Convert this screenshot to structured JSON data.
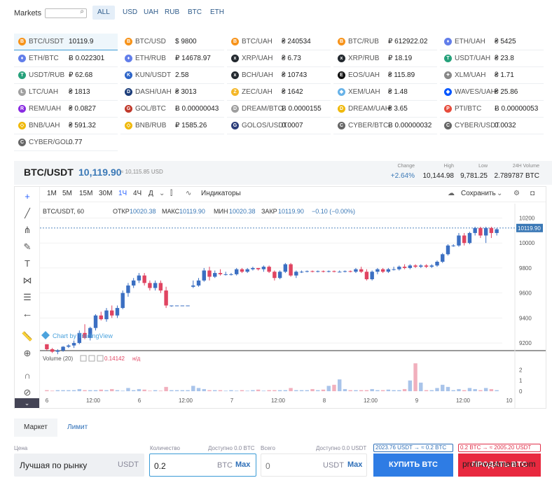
{
  "markets": {
    "title": "Markets",
    "search_icon": "search-icon",
    "currencies": [
      "ALL",
      "USD",
      "UAH",
      "RUB",
      "BTC",
      "ETH"
    ],
    "active_currency": "ALL",
    "pairs": [
      [
        {
          "name": "BTC/USDT",
          "price": "10119.9",
          "icon": "btc-icon",
          "color": "#f7931a",
          "sym": "B"
        },
        {
          "name": "BTC/USD",
          "price": "$ 9800",
          "icon": "btc-icon",
          "color": "#f7931a",
          "sym": "B"
        },
        {
          "name": "BTC/UAH",
          "price": "₴ 240534",
          "icon": "btc-icon",
          "color": "#f7931a",
          "sym": "B"
        },
        {
          "name": "BTC/RUB",
          "price": "₽ 612922.02",
          "icon": "btc-icon",
          "color": "#f7931a",
          "sym": "B"
        },
        {
          "name": "ETH/UAH",
          "price": "₴ 5425",
          "icon": "eth-icon",
          "color": "#627eea",
          "sym": "♦"
        }
      ],
      [
        {
          "name": "ETH/BTC",
          "price": "Ƀ 0.022301",
          "icon": "eth-icon",
          "color": "#627eea",
          "sym": "♦"
        },
        {
          "name": "ETH/RUB",
          "price": "₽ 14678.97",
          "icon": "eth-icon",
          "color": "#627eea",
          "sym": "♦"
        },
        {
          "name": "XRP/UAH",
          "price": "₴ 6.73",
          "icon": "xrp-icon",
          "color": "#23292f",
          "sym": "x"
        },
        {
          "name": "XRP/RUB",
          "price": "₽ 18.19",
          "icon": "xrp-icon",
          "color": "#23292f",
          "sym": "x"
        },
        {
          "name": "USDT/UAH",
          "price": "₴ 23.8",
          "icon": "usdt-icon",
          "color": "#26a17b",
          "sym": "T"
        }
      ],
      [
        {
          "name": "USDT/RUB",
          "price": "₽ 62.68",
          "icon": "usdt-icon",
          "color": "#26a17b",
          "sym": "T"
        },
        {
          "name": "KUN/USDT",
          "price": "2.58",
          "icon": "kun-icon",
          "color": "#2c64c8",
          "sym": "K"
        },
        {
          "name": "BCH/UAH",
          "price": "₴ 10743",
          "icon": "bch-icon",
          "color": "#23292f",
          "sym": "x"
        },
        {
          "name": "EOS/UAH",
          "price": "₴ 115.89",
          "icon": "eos-icon",
          "color": "#111111",
          "sym": "E"
        },
        {
          "name": "XLM/UAH",
          "price": "₴ 1.71",
          "icon": "xlm-icon",
          "color": "#888888",
          "sym": "✦"
        }
      ],
      [
        {
          "name": "LTC/UAH",
          "price": "₴ 1813",
          "icon": "ltc-icon",
          "color": "#a0a0a0",
          "sym": "Ł"
        },
        {
          "name": "DASH/UAH",
          "price": "₴ 3013",
          "icon": "dash-icon",
          "color": "#1c3d7a",
          "sym": "D"
        },
        {
          "name": "ZEC/UAH",
          "price": "₴ 1642",
          "icon": "zec-icon",
          "color": "#f4b728",
          "sym": "Z"
        },
        {
          "name": "XEM/UAH",
          "price": "₴ 1.48",
          "icon": "xem-icon",
          "color": "#67b2e8",
          "sym": "◆"
        },
        {
          "name": "WAVES/UAH",
          "price": "₴ 25.86",
          "icon": "waves-icon",
          "color": "#0055ff",
          "sym": "◆"
        }
      ],
      [
        {
          "name": "REM/UAH",
          "price": "₴ 0.0827",
          "icon": "rem-icon",
          "color": "#8a2be2",
          "sym": "R"
        },
        {
          "name": "GOL/BTC",
          "price": "Ƀ 0.00000043",
          "icon": "gol-icon",
          "color": "#c0392b",
          "sym": "G"
        },
        {
          "name": "DREAM/BTC",
          "price": "Ƀ 0.0000155",
          "icon": "dream-icon",
          "color": "#9e9e9e",
          "sym": "D"
        },
        {
          "name": "DREAM/UAH",
          "price": "₴ 3.65",
          "icon": "dream-icon",
          "color": "#f0b90b",
          "sym": "D"
        },
        {
          "name": "PTI/BTC",
          "price": "Ƀ 0.00000053",
          "icon": "pti-icon",
          "color": "#e74c3c",
          "sym": "P"
        }
      ],
      [
        {
          "name": "BNB/UAH",
          "price": "₴ 591.32",
          "icon": "bnb-icon",
          "color": "#f0b90b",
          "sym": "◇"
        },
        {
          "name": "BNB/RUB",
          "price": "₽ 1585.26",
          "icon": "bnb-icon",
          "color": "#f0b90b",
          "sym": "◇"
        },
        {
          "name": "GOLOS/USDT",
          "price": "0.0007",
          "icon": "golos-icon",
          "color": "#2c3e7a",
          "sym": "G"
        },
        {
          "name": "CYBER/BTC",
          "price": "Ƀ 0.00000032",
          "icon": "cyber-icon",
          "color": "#666666",
          "sym": "C"
        },
        {
          "name": "CYBER/USDT",
          "price": "0.0032",
          "icon": "cyber-icon",
          "color": "#666666",
          "sym": "C"
        }
      ],
      [
        {
          "name": "CYBER/GOL",
          "price": "0.77",
          "icon": "cyber-icon",
          "color": "#666666",
          "sym": "C"
        }
      ]
    ]
  },
  "header": {
    "pair": "BTC/USDT",
    "price": "10,119.90",
    "sub_price": "≈ 10,115.85 USD",
    "stats": [
      {
        "label": "Change",
        "value": "+2.64%",
        "color": "#3a78b6"
      },
      {
        "label": "High",
        "value": "10,144.98",
        "color": "#222"
      },
      {
        "label": "Low",
        "value": "9,781.25",
        "color": "#222"
      },
      {
        "label": "24H Volume",
        "value": "2.789787 BTC",
        "color": "#222"
      }
    ]
  },
  "toolbar": {
    "timeframes": [
      "1M",
      "5M",
      "15M",
      "30M",
      "1Ч",
      "4Ч",
      "Д"
    ],
    "active_timeframe": "1Ч",
    "indicators_label": "Индикаторы",
    "save_label": "Сохранить"
  },
  "legend": {
    "symbol": "BTC/USDT, 60",
    "o_label": "ОТКР",
    "o_val": "10020.38",
    "h_label": "МАКС",
    "h_val": "10119.90",
    "l_label": "МИН",
    "l_val": "10020.38",
    "c_label": "ЗАКР",
    "c_val": "10119.90",
    "change": "−0.10 (−0.00%)",
    "volume_label": "Volume (20)",
    "volume_val": "0.14142",
    "volume_na": "н/д",
    "watermark": "Chart by TradingView"
  },
  "chart_data": {
    "type": "candlestick",
    "price_axis": [
      10200,
      10000,
      9800,
      9600,
      9400,
      9200
    ],
    "price_range": [
      9150,
      10270
    ],
    "current_price_label": "10119.90",
    "volume_axis": [
      2,
      1,
      0
    ],
    "volume_range": [
      0,
      3
    ],
    "time_axis": [
      "6",
      "12:00",
      "6",
      "12:00",
      "7",
      "12:00",
      "8",
      "12:00",
      "9",
      "12:00",
      "10"
    ],
    "candles": [
      [
        9190,
        9190,
        9140,
        9150
      ],
      [
        9150,
        9160,
        9120,
        9130
      ],
      [
        9130,
        9150,
        9110,
        9140
      ],
      [
        9140,
        9175,
        9130,
        9170
      ],
      [
        9170,
        9190,
        9160,
        9180
      ],
      [
        9180,
        9220,
        9160,
        9200
      ],
      [
        9200,
        9300,
        9190,
        9280
      ],
      [
        9280,
        9350,
        9230,
        9240
      ],
      [
        9240,
        9330,
        9220,
        9320
      ],
      [
        9320,
        9430,
        9300,
        9420
      ],
      [
        9420,
        9450,
        9380,
        9390
      ],
      [
        9390,
        9480,
        9370,
        9460
      ],
      [
        9460,
        9500,
        9400,
        9420
      ],
      [
        9420,
        9500,
        9400,
        9480
      ],
      [
        9480,
        9620,
        9470,
        9600
      ],
      [
        9600,
        9680,
        9570,
        9660
      ],
      [
        9660,
        9720,
        9640,
        9700
      ],
      [
        9700,
        9760,
        9680,
        9740
      ],
      [
        9740,
        9760,
        9660,
        9680
      ],
      [
        9680,
        9700,
        9620,
        9640
      ],
      [
        9640,
        9700,
        9620,
        9680
      ],
      [
        9680,
        9700,
        9600,
        9620
      ],
      [
        9620,
        9650,
        9480,
        9500
      ],
      [
        9500,
        9500,
        9490,
        9500
      ],
      [
        9500,
        9500,
        9495,
        9500
      ],
      [
        9500,
        9500,
        9495,
        9500
      ],
      [
        9500,
        9500,
        9495,
        9500
      ],
      [
        9650,
        9700,
        9640,
        9660
      ],
      [
        9660,
        9720,
        9650,
        9700
      ],
      [
        9700,
        9800,
        9690,
        9780
      ],
      [
        9780,
        9810,
        9700,
        9730
      ],
      [
        9730,
        9780,
        9720,
        9760
      ],
      [
        9760,
        9790,
        9740,
        9750
      ],
      [
        9750,
        9770,
        9740,
        9750
      ],
      [
        9750,
        9760,
        9740,
        9750
      ],
      [
        9750,
        9800,
        9740,
        9790
      ],
      [
        9790,
        9800,
        9760,
        9770
      ],
      [
        9770,
        9800,
        9760,
        9790
      ],
      [
        9790,
        9810,
        9780,
        9800
      ],
      [
        9800,
        9800,
        9780,
        9790
      ],
      [
        9790,
        9820,
        9770,
        9810
      ],
      [
        9810,
        9820,
        9760,
        9770
      ],
      [
        9770,
        9780,
        9700,
        9720
      ],
      [
        9720,
        9780,
        9710,
        9770
      ],
      [
        9770,
        9840,
        9760,
        9830
      ],
      [
        9830,
        9840,
        9730,
        9740
      ],
      [
        9740,
        9780,
        9720,
        9770
      ],
      [
        9770,
        9780,
        9760,
        9770
      ],
      [
        9770,
        9780,
        9765,
        9775
      ],
      [
        9775,
        9780,
        9765,
        9770
      ],
      [
        9770,
        9780,
        9765,
        9775
      ],
      [
        9775,
        9780,
        9765,
        9770
      ],
      [
        9770,
        9780,
        9765,
        9775
      ],
      [
        9775,
        9780,
        9765,
        9770
      ],
      [
        9770,
        9780,
        9765,
        9770
      ],
      [
        9770,
        9780,
        9765,
        9775
      ],
      [
        9775,
        9780,
        9765,
        9770
      ],
      [
        9770,
        9800,
        9760,
        9790
      ],
      [
        9790,
        9810,
        9760,
        9770
      ],
      [
        9770,
        9790,
        9700,
        9710
      ],
      [
        9710,
        9780,
        9700,
        9770
      ],
      [
        9770,
        9800,
        9750,
        9790
      ],
      [
        9790,
        9800,
        9760,
        9770
      ],
      [
        9770,
        9800,
        9760,
        9790
      ],
      [
        9790,
        9810,
        9780,
        9790
      ],
      [
        9790,
        9820,
        9780,
        9810
      ],
      [
        9810,
        9830,
        9790,
        9800
      ],
      [
        9800,
        9830,
        9790,
        9820
      ],
      [
        9820,
        9830,
        9800,
        9810
      ],
      [
        9810,
        9830,
        9800,
        9820
      ],
      [
        9820,
        9830,
        9800,
        9810
      ],
      [
        9810,
        9830,
        9800,
        9820
      ],
      [
        9820,
        9860,
        9810,
        9850
      ],
      [
        9850,
        9920,
        9840,
        9910
      ],
      [
        9910,
        9990,
        9900,
        9980
      ],
      [
        9980,
        9990,
        9970,
        9980
      ],
      [
        9980,
        10080,
        9970,
        10060
      ],
      [
        10060,
        10080,
        9980,
        10000
      ],
      [
        10000,
        10090,
        9990,
        10080
      ],
      [
        10080,
        10130,
        10060,
        10120
      ],
      [
        10120,
        10130,
        10040,
        10060
      ],
      [
        10060,
        10130,
        10000,
        10120
      ],
      [
        10120,
        10130,
        10040,
        10080
      ],
      [
        10080,
        10120,
        10060,
        10110
      ]
    ],
    "volumes": [
      0.1,
      0.05,
      0.1,
      0.1,
      0.1,
      0.1,
      0.2,
      0.1,
      0.1,
      0.1,
      0.15,
      0.1,
      0.2,
      0.1,
      0.05,
      0.3,
      0.1,
      0.2,
      0.15,
      0.05,
      0.1,
      0.05,
      0.4,
      0.1,
      0.1,
      0.1,
      0.1,
      0.5,
      0.3,
      0.2,
      0.1,
      0.1,
      0.1,
      0.05,
      0.1,
      0.05,
      0.1,
      0.05,
      0.1,
      0.15,
      0.05,
      0.1,
      0.1,
      0.1,
      0.1,
      0.3,
      0.1,
      0.1,
      0.1,
      0.2,
      0.1,
      0.15,
      0.5,
      0.6,
      1.1,
      0.2,
      0.1,
      0.1,
      0.1,
      0.1,
      0.2,
      0.1,
      0.1,
      0.15,
      0.1,
      0.1,
      0.2,
      1.0,
      2.6,
      0.8,
      0.1,
      0.1,
      0.3,
      0.6,
      0.4,
      0.1,
      0.2,
      0.1,
      0.3,
      0.2,
      0.1,
      0.3,
      0.2,
      0.1
    ]
  },
  "order": {
    "tabs": [
      "Маркет",
      "Лимит"
    ],
    "active_tab": "Маркет",
    "price_label": "Цена",
    "price_value": "Лучшая по рынку",
    "price_unit": "USDT",
    "qty_label": "Количество",
    "qty_avail": "Доступно 0.0 BTC",
    "qty_value": "0.2",
    "qty_unit": "BTC",
    "max_label": "Max",
    "total_label": "Всего",
    "total_avail": "Доступно 0.0 USDT",
    "total_value": "0",
    "total_unit": "USDT",
    "buy_info": "2023.76  USDT  →  ≈  0.2  BTC",
    "sell_info": "0.2  BTC  →  ≈  2005.20  USDT",
    "buy_label": "КУПИТЬ BTC",
    "sell_label": "ПРОДАТЬ BTC",
    "watermark": "profinvestment.com"
  }
}
